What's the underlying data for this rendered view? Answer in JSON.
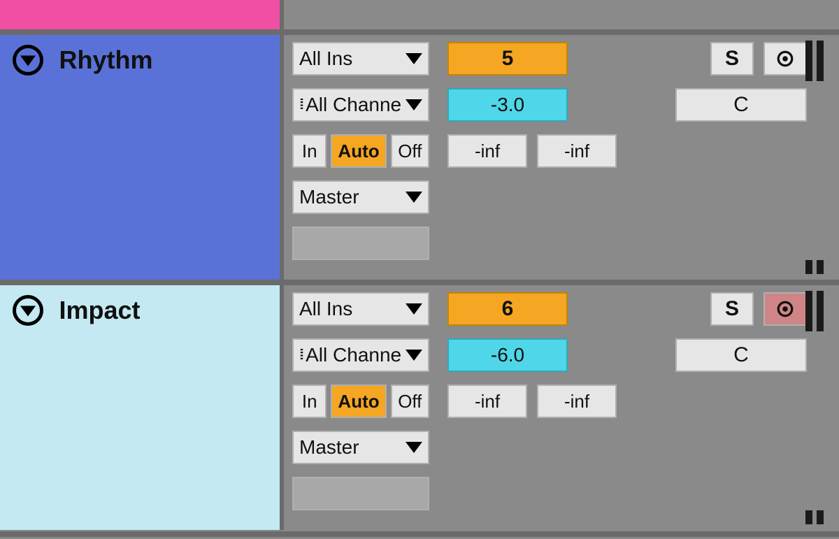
{
  "tracks": [
    {
      "name": "Rhythm",
      "color": "#5a72d8",
      "io": {
        "input_type": "All Ins",
        "input_channel": "All Channe",
        "monitor": {
          "in": "In",
          "auto": "Auto",
          "off": "Off",
          "active": "auto"
        },
        "output": "Master"
      },
      "mixer": {
        "number": "5",
        "volume_db": "-3.0",
        "pan": "C",
        "solo_label": "S",
        "record_armed": false,
        "sends": [
          "-inf",
          "-inf"
        ]
      }
    },
    {
      "name": "Impact",
      "color": "#c4e9f2",
      "io": {
        "input_type": "All Ins",
        "input_channel": "All Channe",
        "monitor": {
          "in": "In",
          "auto": "Auto",
          "off": "Off",
          "active": "auto"
        },
        "output": "Master"
      },
      "mixer": {
        "number": "6",
        "volume_db": "-6.0",
        "pan": "C",
        "solo_label": "S",
        "record_armed": true,
        "sends": [
          "-inf",
          "-inf"
        ]
      }
    }
  ],
  "colors": {
    "pink_track": "#f04fa3",
    "highlight_orange": "#f5a623",
    "volume_cyan": "#4fd6e8",
    "armed_red": "#cf8585"
  }
}
